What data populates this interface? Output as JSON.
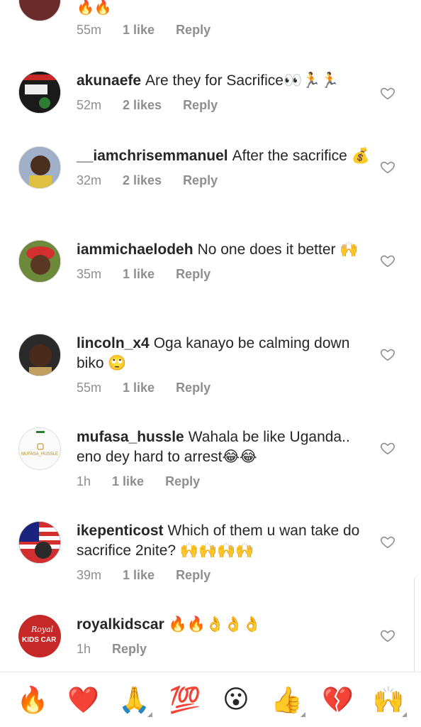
{
  "partial_comment": {
    "time": "55m",
    "likes": "1 like",
    "reply": "Reply",
    "emoji": "🔥🔥"
  },
  "comments": [
    {
      "user": "akunaefe",
      "text": "Are they for Sacrifice👀🏃🏃",
      "time": "52m",
      "likes": "2 likes",
      "reply": "Reply"
    },
    {
      "user": "__iamchrisemmanuel",
      "text": "After the sacrifice 💰",
      "time": "32m",
      "likes": "2 likes",
      "reply": "Reply"
    },
    {
      "user": "iammichaelodeh",
      "text": "No one does it better 🙌",
      "time": "35m",
      "likes": "1 like",
      "reply": "Reply"
    },
    {
      "user": "lincoln_x4",
      "text": "Oga kanayo be calming down biko 🙄",
      "time": "55m",
      "likes": "1 like",
      "reply": "Reply"
    },
    {
      "user": "mufasa_hussle",
      "text": "Wahala be like Uganda.. eno dey hard to arrest😂😂",
      "time": "1h",
      "likes": "1 like",
      "reply": "Reply"
    },
    {
      "user": "ikepenticost",
      "text": "Which of them u wan take do sacrifice 2nite? 🙌🙌🙌🙌",
      "time": "39m",
      "likes": "1 like",
      "reply": "Reply"
    },
    {
      "user": "royalkidscar",
      "text": "🔥🔥👌👌👌",
      "time": "1h",
      "likes": "",
      "reply": "Reply"
    }
  ],
  "avatars": {
    "akunaefe": "akunaefe-avatar",
    "mufasa_hussle_label": "MUFASA_HUSSLE",
    "royalkidscar_label": "KIDS CAR",
    "royalkidscar_script": "Royal"
  },
  "emoji_bar": [
    "🔥",
    "❤️",
    "🙏",
    "💯",
    "😮",
    "👍",
    "💔",
    "🙌"
  ]
}
